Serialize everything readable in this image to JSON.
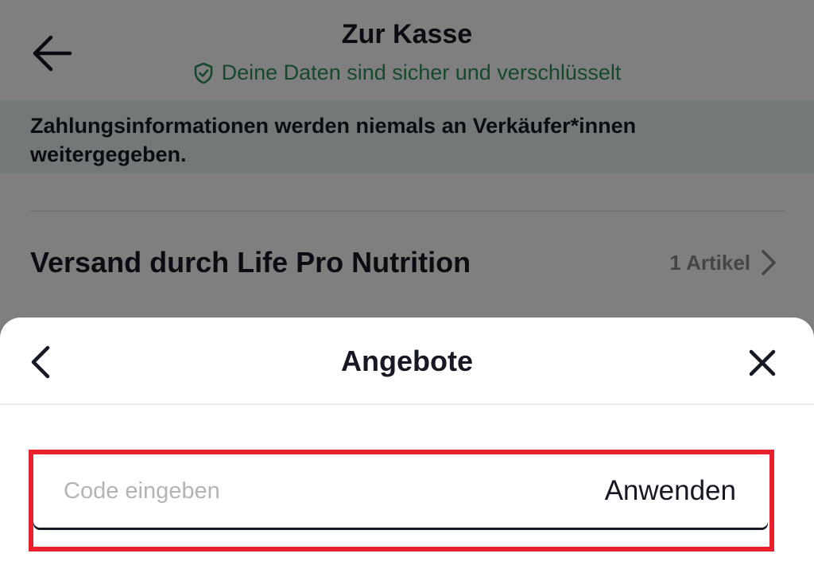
{
  "header": {
    "title": "Zur Kasse",
    "secure_text": "Deine Daten sind sicher und verschlüsselt"
  },
  "banner": {
    "text": "Zahlungsinformationen werden niemals an Verkäufer*innen weitergegeben."
  },
  "shipping": {
    "title": "Versand durch Life Pro Nutrition",
    "item_count": "1 Artikel"
  },
  "sheet": {
    "title": "Angebote",
    "code_input": {
      "value": "",
      "placeholder": "Code eingeben"
    },
    "apply_label": "Anwenden"
  },
  "colors": {
    "secure_green": "#2f8f5b",
    "banner_bg": "#e4f2f1",
    "highlight_red": "#e8202e",
    "text_dark": "#161823",
    "text_muted": "#8a8b91"
  },
  "icons": {
    "back": "arrow-left-icon",
    "secure": "shield-check-icon",
    "chevron": "chevron-right-icon",
    "sheet_back": "chevron-left-icon",
    "close": "close-icon"
  }
}
